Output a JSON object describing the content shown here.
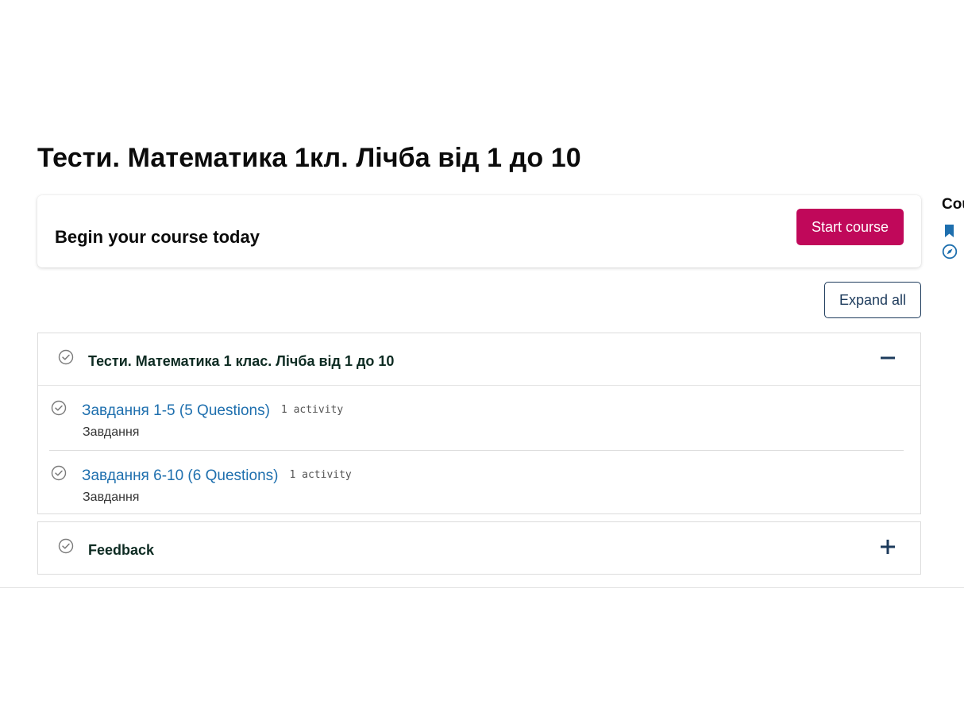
{
  "page": {
    "title": "Тести. Математика 1кл. Лічба від 1 до 10"
  },
  "begin_card": {
    "text": "Begin your course today",
    "start_button": "Start course"
  },
  "controls": {
    "expand_all": "Expand all"
  },
  "sections": [
    {
      "title": "Тести. Математика 1 клас. Лічба від 1 до 10",
      "expanded": true,
      "toggle_icon": "minus-icon",
      "activities": [
        {
          "title": "Завдання 1-5 (5 Questions)",
          "count": "1 activity",
          "type": "Завдання"
        },
        {
          "title": "Завдання 6-10 (6 Questions)",
          "count": "1 activity",
          "type": "Завдання"
        }
      ]
    },
    {
      "title": "Feedback",
      "expanded": false,
      "toggle_icon": "plus-icon",
      "activities": []
    }
  ],
  "right_panel": {
    "title": "Cou",
    "icons": [
      "bookmark-icon",
      "compass-icon"
    ]
  },
  "colors": {
    "accent": "#c0085a",
    "link": "#1e6fae",
    "navy": "#1d3b5c",
    "section_title": "#0d2b22"
  }
}
